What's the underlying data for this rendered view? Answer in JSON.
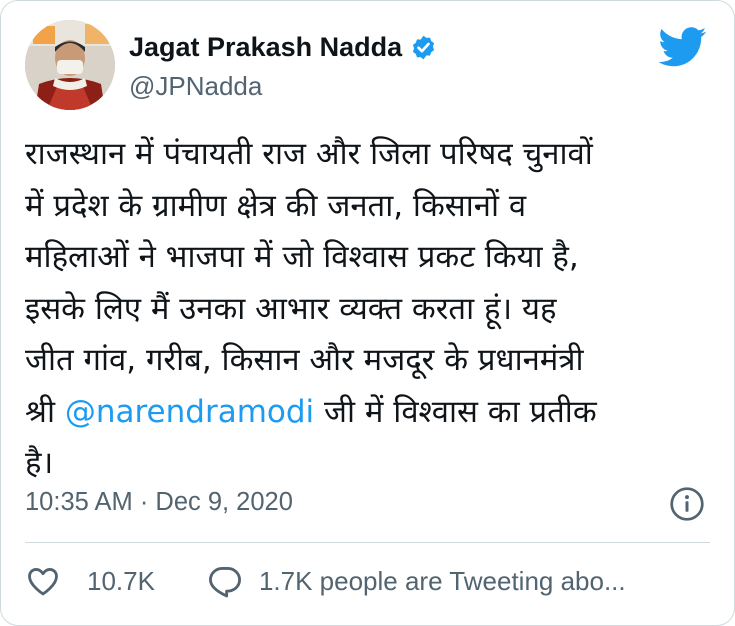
{
  "tweet": {
    "author_name": "Jagat Prakash Nadda",
    "author_handle": "@JPNadda",
    "text_lines": [
      "राजस्थान में पंचायती राज और जिला परिषद चुनावों",
      "में प्रदेश के ग्रामीण क्षेत्र की जनता, किसानों व",
      "महिलाओं ने भाजपा में जो विश्वास प्रकट किया है,",
      "इसके लिए मैं उनका आभार व्यक्त करता हूं। यह",
      "जीत गांव, गरीब, किसान और मजदूर के प्रधानमंत्री"
    ],
    "line6_prefix": "श्री ",
    "mention": "@narendramodi",
    "line6_suffix": " जी में विश्वास का प्रतीक",
    "last_line": "है।",
    "timestamp": "10:35 AM · Dec 9, 2020",
    "likes": "10.7K",
    "tweeting_about": "1.7K people are Tweeting abo..."
  },
  "icons": {
    "verified": "verified-badge-icon",
    "bird": "twitter-bird-icon",
    "info": "info-icon",
    "like": "heart-icon",
    "reply": "speech-bubble-icon"
  },
  "colors": {
    "brand_blue": "#1d9bf0",
    "text_primary": "#0f1419",
    "text_secondary": "#536471",
    "border": "#cfd9de"
  }
}
